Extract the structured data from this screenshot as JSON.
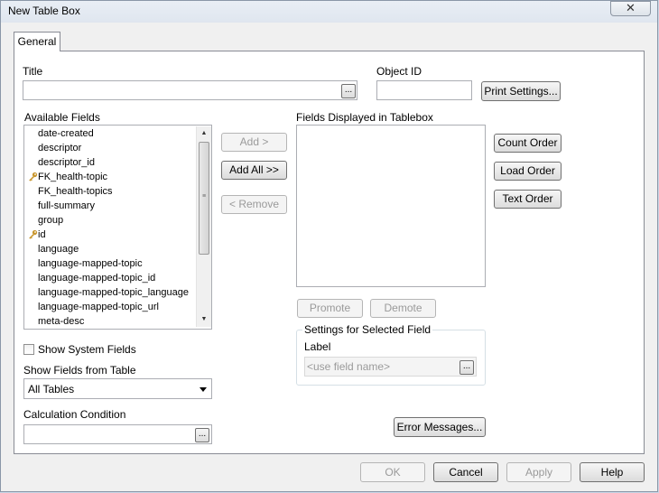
{
  "window": {
    "title": "New Table Box",
    "close_glyph": "✕"
  },
  "tabs": [
    {
      "label": "General"
    }
  ],
  "title_field": {
    "label": "Title",
    "value": "",
    "ellipsis": "..."
  },
  "object_id": {
    "label": "Object ID",
    "value": ""
  },
  "buttons": {
    "print_settings": "Print Settings...",
    "add": "Add >",
    "add_all": "Add All >>",
    "remove": "< Remove",
    "count_order": "Count Order",
    "load_order": "Load Order",
    "text_order": "Text Order",
    "promote": "Promote",
    "demote": "Demote",
    "error_messages": "Error Messages...",
    "ok": "OK",
    "cancel": "Cancel",
    "apply": "Apply",
    "help": "Help"
  },
  "available_fields": {
    "label": "Available Fields",
    "items": [
      {
        "name": "date-created",
        "key": false
      },
      {
        "name": "descriptor",
        "key": false
      },
      {
        "name": "descriptor_id",
        "key": false
      },
      {
        "name": "FK_health-topic",
        "key": true
      },
      {
        "name": "FK_health-topics",
        "key": false
      },
      {
        "name": "full-summary",
        "key": false
      },
      {
        "name": "group",
        "key": false
      },
      {
        "name": "id",
        "key": true
      },
      {
        "name": "language",
        "key": false
      },
      {
        "name": "language-mapped-topic",
        "key": false
      },
      {
        "name": "language-mapped-topic_id",
        "key": false
      },
      {
        "name": "language-mapped-topic_language",
        "key": false
      },
      {
        "name": "language-mapped-topic_url",
        "key": false
      },
      {
        "name": "meta-desc",
        "key": false
      }
    ]
  },
  "fields_displayed": {
    "label": "Fields Displayed in Tablebox",
    "items": []
  },
  "show_system_fields": {
    "label": "Show System Fields",
    "checked": false
  },
  "show_fields_from_table": {
    "label": "Show Fields from Table",
    "selected": "All Tables"
  },
  "calculation_condition": {
    "label": "Calculation Condition",
    "value": "",
    "ellipsis": "..."
  },
  "selected_field_settings": {
    "group_label": "Settings for Selected Field",
    "label_label": "Label",
    "placeholder": "<use field name>",
    "ellipsis": "..."
  },
  "colors": {
    "accent_key": "#c8962e",
    "panel_border": "#898c95",
    "window_bg": "#f0f0f0"
  },
  "icons": {
    "key": "key-icon",
    "scroll_up": "scroll-up-icon",
    "scroll_down": "scroll-down-icon",
    "dropdown": "dropdown-arrow-icon"
  }
}
